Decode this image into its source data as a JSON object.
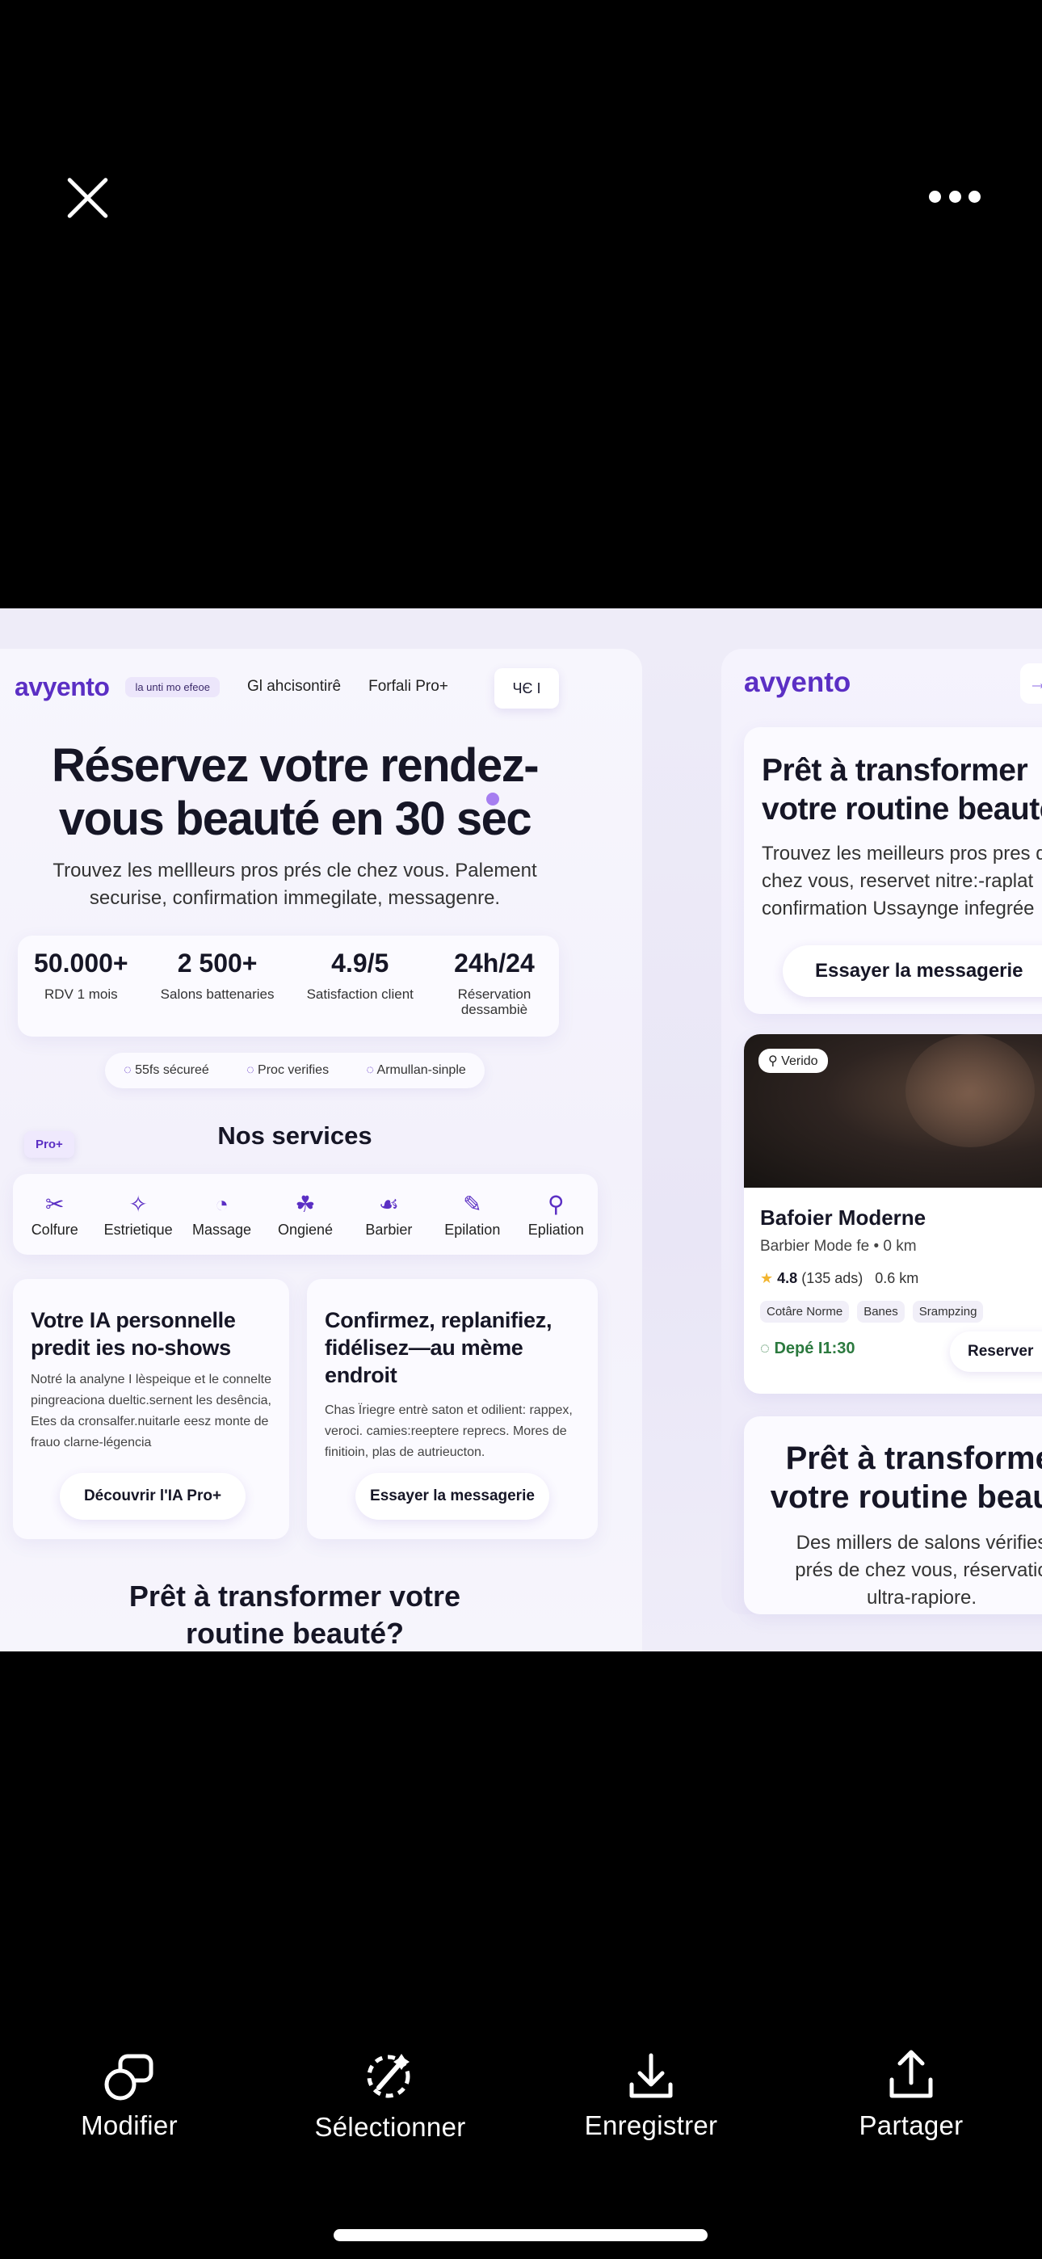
{
  "viewer": {
    "toolbar": {
      "modify": "Modifier",
      "select": "Sélectionner",
      "save": "Enregistrer",
      "share": "Partager"
    }
  },
  "left": {
    "logo": "avyento",
    "chip": "la unti mo efeoe",
    "nav_links": [
      "Gl ahcisontirê",
      "Forfali Pro+"
    ],
    "lang": "ЧЄ I",
    "hero": "Réservez votre rendez-vous beauté en 30 sec",
    "subtitle": "Trouvez les mellleurs pros prés cle chez vous. Palement securise, confirmation immegilate, messagenre.",
    "stats": [
      {
        "value": "50.000+",
        "label": "RDV 1 mois"
      },
      {
        "value": "2 500+",
        "label": "Salons battenaries"
      },
      {
        "value": "4.9/5",
        "label": "Satisfaction client"
      },
      {
        "value": "24h/24",
        "label": "Réservation dessambiè"
      }
    ],
    "trust": [
      "55fs sécureé",
      "Proc verifies",
      "Armullan-sinple"
    ],
    "pro_badge": "Pro+",
    "services_title": "Nos services",
    "services": [
      {
        "label": "Colfure",
        "icon": "scissors-icon"
      },
      {
        "label": "Estrietique",
        "icon": "sparkle-icon"
      },
      {
        "label": "Massage",
        "icon": "massage-icon"
      },
      {
        "label": "Ongiené",
        "icon": "nail-icon"
      },
      {
        "label": "Barbier",
        "icon": "razor-icon"
      },
      {
        "label": "Epilation",
        "icon": "wax-icon"
      },
      {
        "label": "Epliation",
        "icon": "laser-icon"
      }
    ],
    "card_ai": {
      "title": "Votre IA personnelle predit ies no-shows",
      "body": "Notré la analyne I lèspeique et le connelte pingreaciona dueltic.sernent les desência, Etes da cronsalfer.nuitarle eesz monte de frauo clarne-légencia",
      "button": "Découvrir l'IA Pro+"
    },
    "card_msg": {
      "title": "Confirmez, replanifiez, fidélisez—au mème endroit",
      "body": "Chas Ïriegre entrè saton et odilient: rappex, veroci. camies:reeptere reprecs. Mores de finitioin, plas de autrieucton.",
      "button": "Essayer la messagerie"
    },
    "cta": "Prêt à transformer votre routine beauté?"
  },
  "right": {
    "logo": "avyento",
    "arrow": "→",
    "panel1": {
      "title": "Prêt à transformer votre routine beauté",
      "body": "Trouvez les meilleurs pros pres de chez vous, reservet nitre:-raplat confirmation Ussayngе infegrée",
      "button": "Essayer la messagerie"
    },
    "salon": {
      "verified": "Verido",
      "name": "Bafoier Moderne",
      "sub": "Barbier Mode fe • 0 km",
      "rating": "4.8",
      "reviews": "(135 ads)",
      "distance": "0.6 km",
      "tags": [
        "Cotâre Norme",
        "Banes",
        "Srampzing"
      ],
      "time": "Depé I1:30",
      "reserve": "Reserver"
    },
    "panel3": {
      "title": "Prêt à transformer votre routine beauté",
      "body": "Des millers de salons vérifies prés de chez vous, réservatio ultra-rapiore."
    }
  }
}
